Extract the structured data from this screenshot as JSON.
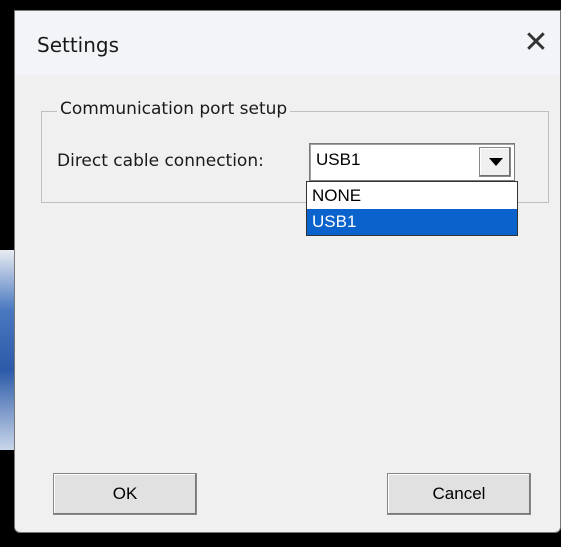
{
  "dialog": {
    "title": "Settings",
    "close_glyph": "✕"
  },
  "group": {
    "legend": "Communication port setup",
    "field_label": "Direct cable connection:",
    "combo": {
      "selected_value": "USB1",
      "options": [
        "NONE",
        "USB1"
      ],
      "highlighted_option": "USB1"
    }
  },
  "buttons": {
    "ok_label": "OK",
    "cancel_label": "Cancel"
  },
  "colors": {
    "highlight": "#0a62cc",
    "dialog_bg": "#f0f0f0"
  },
  "icons": {
    "close": "close-icon",
    "dropdown": "chevron-down-icon"
  }
}
